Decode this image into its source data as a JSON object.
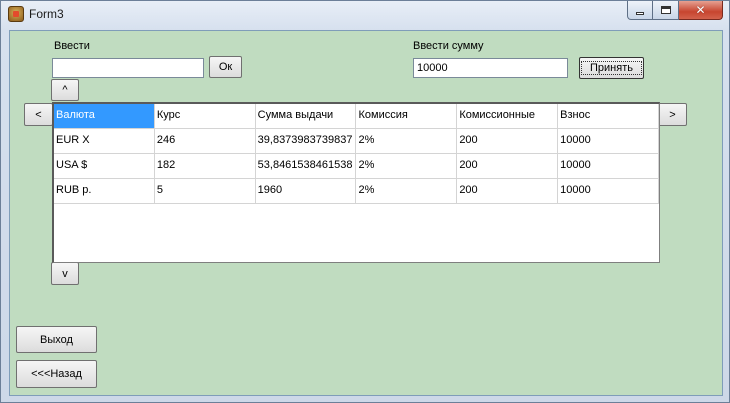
{
  "window": {
    "title": "Form3"
  },
  "controls": {
    "vvesti_label": "Ввести",
    "vvesti_value": "",
    "ok_label": "Ок",
    "summa_label": "Ввести сумму",
    "summa_value": "10000",
    "prinyat_label": "Принять",
    "up_label": "^",
    "down_label": "v",
    "left_label": "<",
    "right_label": ">",
    "exit_label": "Выход",
    "back_label": "<<<Назад"
  },
  "grid": {
    "columns": [
      "Валюта",
      "Курс",
      "Сумма выдачи",
      "Комиссия",
      "Комиссионные",
      "Взнос"
    ],
    "rows": [
      [
        "EUR Χ",
        "246",
        "39,8373983739837",
        "2%",
        "200",
        "10000"
      ],
      [
        "USA $",
        "182",
        "53,8461538461538",
        "2%",
        "200",
        "10000"
      ],
      [
        "RUB р.",
        "5",
        "1960",
        "2%",
        "200",
        "10000"
      ]
    ],
    "selected_cell": "header-0"
  }
}
